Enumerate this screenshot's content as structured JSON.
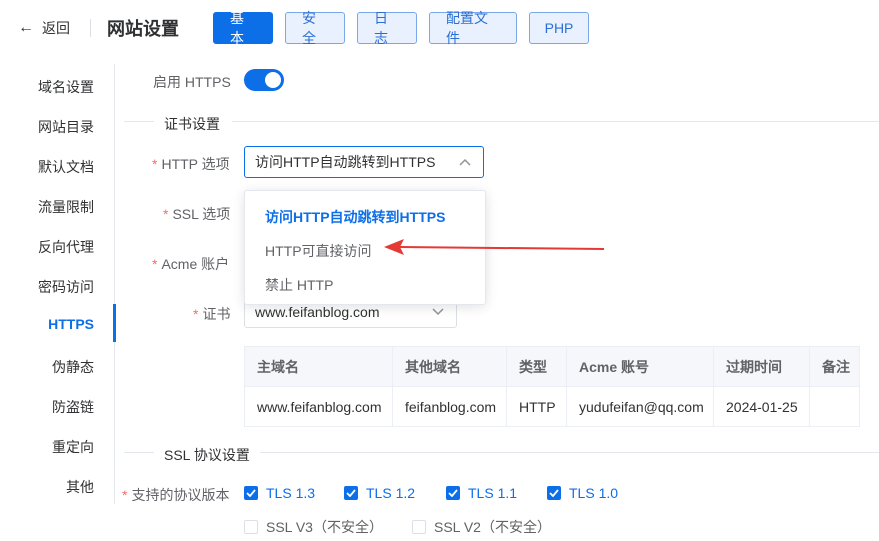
{
  "header": {
    "back_label": "返回",
    "title": "网站设置",
    "tabs": [
      {
        "label": "基本",
        "active": true
      },
      {
        "label": "安全",
        "active": false
      },
      {
        "label": "日志",
        "active": false
      },
      {
        "label": "配置文件",
        "active": false
      },
      {
        "label": "PHP",
        "active": false
      }
    ]
  },
  "sidebar": {
    "items": [
      {
        "label": "域名设置"
      },
      {
        "label": "网站目录"
      },
      {
        "label": "默认文档"
      },
      {
        "label": "流量限制"
      },
      {
        "label": "反向代理"
      },
      {
        "label": "密码访问"
      },
      {
        "label": "HTTPS",
        "active": true
      },
      {
        "label": "伪静态"
      },
      {
        "label": "防盗链"
      },
      {
        "label": "重定向"
      },
      {
        "label": "其他"
      }
    ]
  },
  "form": {
    "enable_https_label": "启用 HTTPS",
    "enable_https": true,
    "cert_section": "证书设置",
    "http_option_label": "HTTP 选项",
    "http_option_value": "访问HTTP自动跳转到HTTPS",
    "ssl_option_label": "SSL 选项",
    "acme_label": "Acme 账户",
    "cert_label": "证书",
    "cert_value": "www.feifanblog.com",
    "dropdown_options": [
      {
        "label": "访问HTTP自动跳转到HTTPS",
        "selected": true
      },
      {
        "label": "HTTP可直接访问",
        "selected": false
      },
      {
        "label": "禁止 HTTP",
        "selected": false
      }
    ],
    "ssl_protocol_section": "SSL 协议设置",
    "protocol_label": "支持的协议版本",
    "protocols": [
      {
        "label": "TLS 1.3",
        "checked": true
      },
      {
        "label": "TLS 1.2",
        "checked": true
      },
      {
        "label": "TLS 1.1",
        "checked": true
      },
      {
        "label": "TLS 1.0",
        "checked": true
      },
      {
        "label": "SSL V3（不安全）",
        "checked": false
      },
      {
        "label": "SSL V2（不安全）",
        "checked": false
      }
    ]
  },
  "cert_table": {
    "headers": [
      "主域名",
      "其他域名",
      "类型",
      "Acme 账号",
      "过期时间",
      "备注"
    ],
    "rows": [
      [
        "www.feifanblog.com",
        "feifanblog.com",
        "HTTP",
        "yudufeifan@qq.com",
        "2024-01-25",
        ""
      ]
    ]
  },
  "colors": {
    "primary": "#0d6fe8",
    "annotation_arrow": "#e53935",
    "required": "#f56c6c"
  }
}
